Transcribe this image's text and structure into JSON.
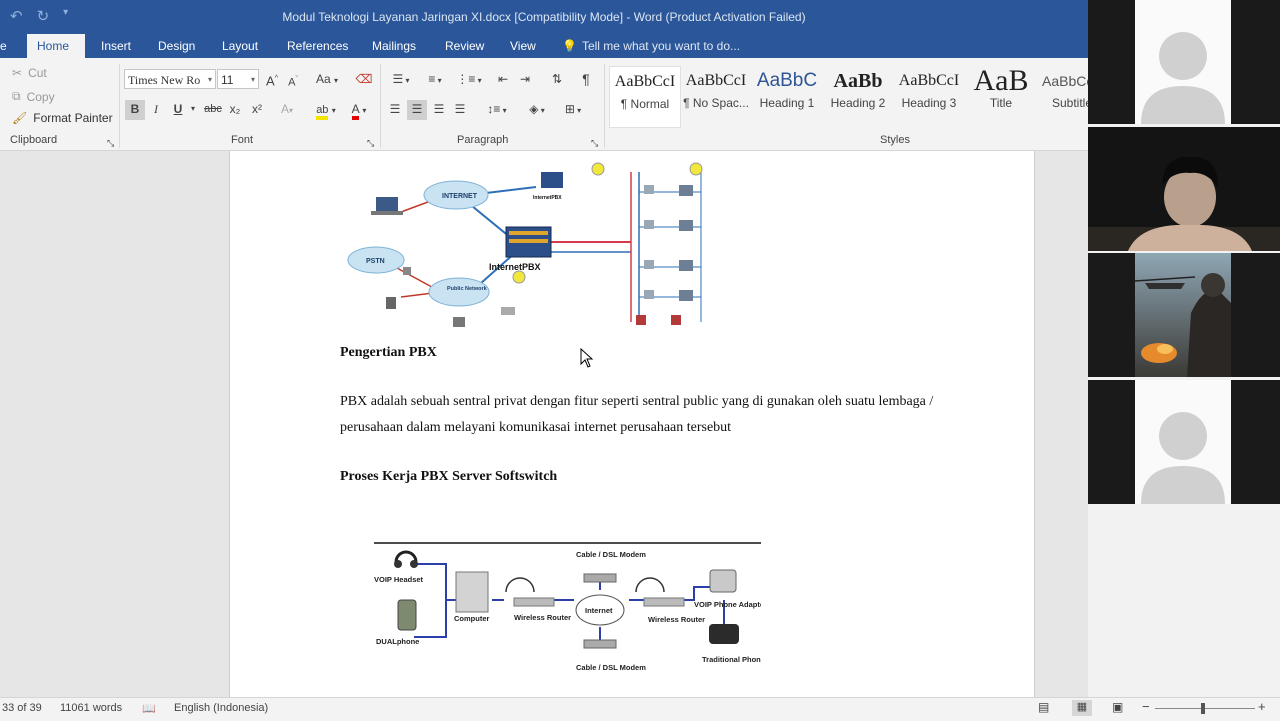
{
  "titlebar": {
    "title": "Modul Teknologi Layanan Jaringan XI.docx [Compatibility Mode] - Word (Product Activation Failed)"
  },
  "tabs": [
    {
      "label": "e",
      "active": false
    },
    {
      "label": "Home",
      "active": true
    },
    {
      "label": "Insert",
      "active": false
    },
    {
      "label": "Design",
      "active": false
    },
    {
      "label": "Layout",
      "active": false
    },
    {
      "label": "References",
      "active": false
    },
    {
      "label": "Mailings",
      "active": false
    },
    {
      "label": "Review",
      "active": false
    },
    {
      "label": "View",
      "active": false
    }
  ],
  "tellme": "Tell me what you want to do...",
  "clipboard": {
    "cut": "Cut",
    "copy": "Copy",
    "format_painter": "Format Painter",
    "group_label": "Clipboard"
  },
  "font": {
    "name": "Times New Ro",
    "size": "11",
    "group_label": "Font",
    "bold": "B",
    "italic": "I",
    "underline": "U",
    "strike": "abc",
    "sub": "x₂",
    "sup": "x²",
    "case": "Aa",
    "grow": "A",
    "shrink": "A",
    "font_color": "A",
    "effects": "A",
    "highlight": "ab"
  },
  "paragraph": {
    "group_label": "Paragraph",
    "pilcrow": "¶"
  },
  "styles": {
    "group_label": "Styles",
    "items": [
      {
        "preview": "AaBbCcI",
        "name": "¶ Normal"
      },
      {
        "preview": "AaBbCcI",
        "name": "¶ No Spac..."
      },
      {
        "preview": "AaBbC",
        "name": "Heading 1"
      },
      {
        "preview": "AaBb",
        "name": "Heading 2"
      },
      {
        "preview": "AaBbCcI",
        "name": "Heading 3"
      },
      {
        "preview": "AaB",
        "name": "Title"
      },
      {
        "preview": "AaBbCc",
        "name": "Subtitle"
      }
    ]
  },
  "document": {
    "heading1": "Pengertian PBX",
    "para1_line1": "PBX adalah sebuah sentral privat dengan fitur seperti sentral public yang di gunakan oleh suatu lembaga /",
    "para1_line2": "perusahaan dalam melayani komunikasai internet perusahaan tersebut",
    "heading2": "Proses Kerja PBX Server Softswitch",
    "diagram1": {
      "internet": "INTERNET",
      "pstn": "PSTN",
      "public_network": "Public Network",
      "brand": "InternetPBX",
      "brand2": "InternetPBX"
    },
    "diagram2": {
      "voip_headset": "VOIP Headset",
      "dualphone": "DUALphone",
      "computer": "Computer",
      "wireless_router_1": "Wireless Router",
      "modem_top": "Cable / DSL Modem",
      "internet": "Internet",
      "modem_bottom": "Cable / DSL Modem",
      "wireless_router_2": "Wireless Router",
      "voip_adaptor": "VOIP Phone Adaptor",
      "traditional_phone": "Traditional Phone"
    }
  },
  "status": {
    "page": "33 of 39",
    "words": "11061 words",
    "language": "English (Indonesia)"
  },
  "colors": {
    "word_blue": "#2b579a"
  }
}
